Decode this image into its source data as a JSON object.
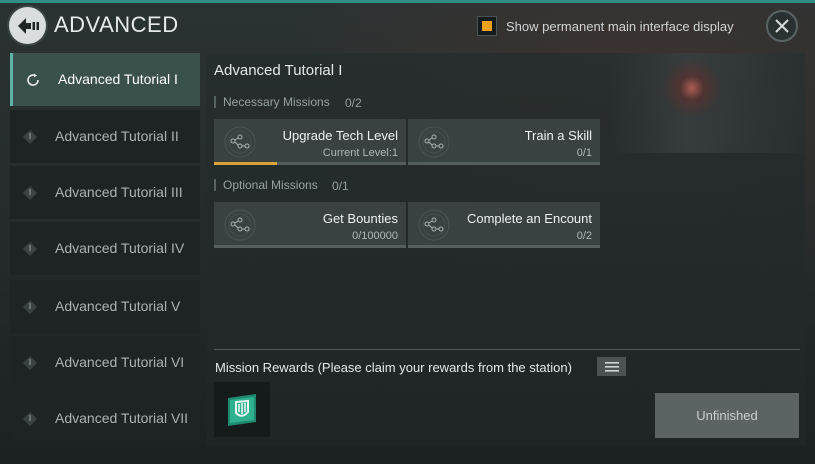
{
  "header": {
    "title": "ADVANCED",
    "toggle_label": "Show permanent main interface display",
    "toggle_checked": true,
    "accent_color": "#f0a21c"
  },
  "sidebar": {
    "items": [
      {
        "label": "Advanced Tutorial I",
        "active": true,
        "icon": "refresh-icon"
      },
      {
        "label": "Advanced Tutorial II",
        "active": false,
        "icon": "locked-diamond-icon"
      },
      {
        "label": "Advanced Tutorial III",
        "active": false,
        "icon": "locked-diamond-icon"
      },
      {
        "label": "Advanced Tutorial IV",
        "active": false,
        "icon": "locked-diamond-icon"
      },
      {
        "label": "Advanced Tutorial V",
        "active": false,
        "icon": "locked-diamond-icon"
      },
      {
        "label": "Advanced Tutorial VI",
        "active": false,
        "icon": "locked-diamond-icon"
      },
      {
        "label": "Advanced Tutorial VII",
        "active": false,
        "icon": "locked-diamond-icon"
      }
    ]
  },
  "main": {
    "title": "Advanced Tutorial I",
    "necessary": {
      "label": "Necessary Missions",
      "count": "0/2",
      "missions": [
        {
          "name": "Upgrade Tech Level",
          "progress": "Current Level:1",
          "fill": 0.33
        },
        {
          "name": "Train a Skill",
          "progress": "0/1",
          "fill": 0
        }
      ]
    },
    "optional": {
      "label": "Optional Missions",
      "count": "0/1",
      "missions": [
        {
          "name": "Get Bounties",
          "progress": "0/100000",
          "fill": 0
        },
        {
          "name": "Complete an Encount",
          "progress": "0/2",
          "fill": 0
        }
      ]
    },
    "rewards_label": "Mission Rewards (Please claim your rewards from the station)",
    "reward_icon": "shield-badge-icon",
    "status_button": "Unfinished"
  }
}
